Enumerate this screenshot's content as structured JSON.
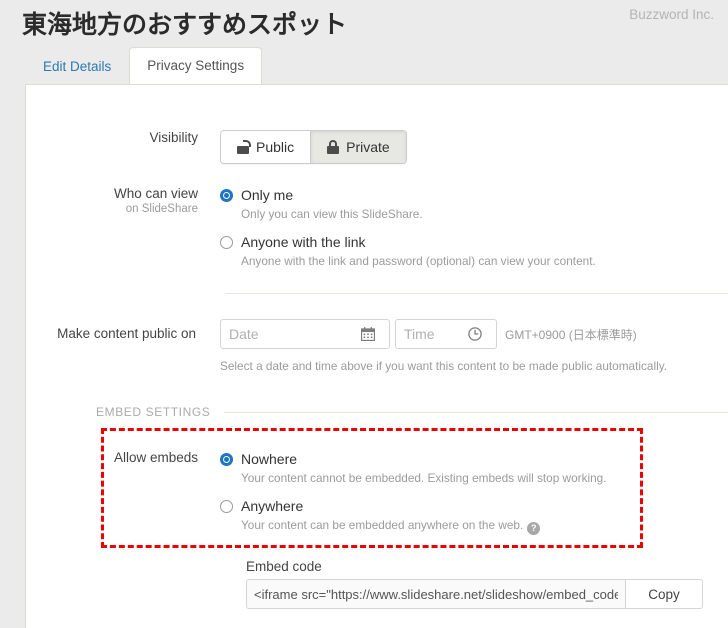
{
  "header": {
    "title": "東海地方のおすすめスポット",
    "brand": "Buzzword Inc."
  },
  "tabs": [
    {
      "label": "Edit Details",
      "active": false
    },
    {
      "label": "Privacy Settings",
      "active": true
    }
  ],
  "visibility": {
    "label": "Visibility",
    "options": [
      {
        "label": "Public",
        "icon": "unlock-icon",
        "selected": false
      },
      {
        "label": "Private",
        "icon": "lock-icon",
        "selected": true
      }
    ]
  },
  "who_can_view": {
    "label": "Who can view",
    "sublabel": "on SlideShare",
    "options": [
      {
        "label": "Only me",
        "description": "Only you can view this SlideShare.",
        "selected": true
      },
      {
        "label": "Anyone with the link",
        "description": "Anyone with the link and password (optional) can view your content.",
        "selected": false
      }
    ]
  },
  "make_public": {
    "label": "Make content public on",
    "date_placeholder": "Date",
    "date_value": "",
    "date_icon": "calendar-icon",
    "time_placeholder": "Time",
    "time_value": "",
    "time_icon": "clock-icon",
    "timezone": "GMT+0900 (日本標準時)",
    "hint": "Select a date and time above if you want this content to be made public automatically."
  },
  "embed_settings": {
    "section_title": "EMBED SETTINGS",
    "allow_embeds": {
      "label": "Allow embeds",
      "options": [
        {
          "label": "Nowhere",
          "description": "Your content cannot be embedded. Existing embeds will stop working.",
          "selected": true,
          "help": false
        },
        {
          "label": "Anywhere",
          "description": "Your content can be embedded anywhere on the web.",
          "selected": false,
          "help": true,
          "help_glyph": "?"
        }
      ]
    },
    "embed_code": {
      "label": "Embed code",
      "value": "<iframe src=\"https://www.slideshare.net/slideshow/embed_code/",
      "copy_label": "Copy"
    }
  },
  "annotation": {
    "color": "#ee0000"
  }
}
